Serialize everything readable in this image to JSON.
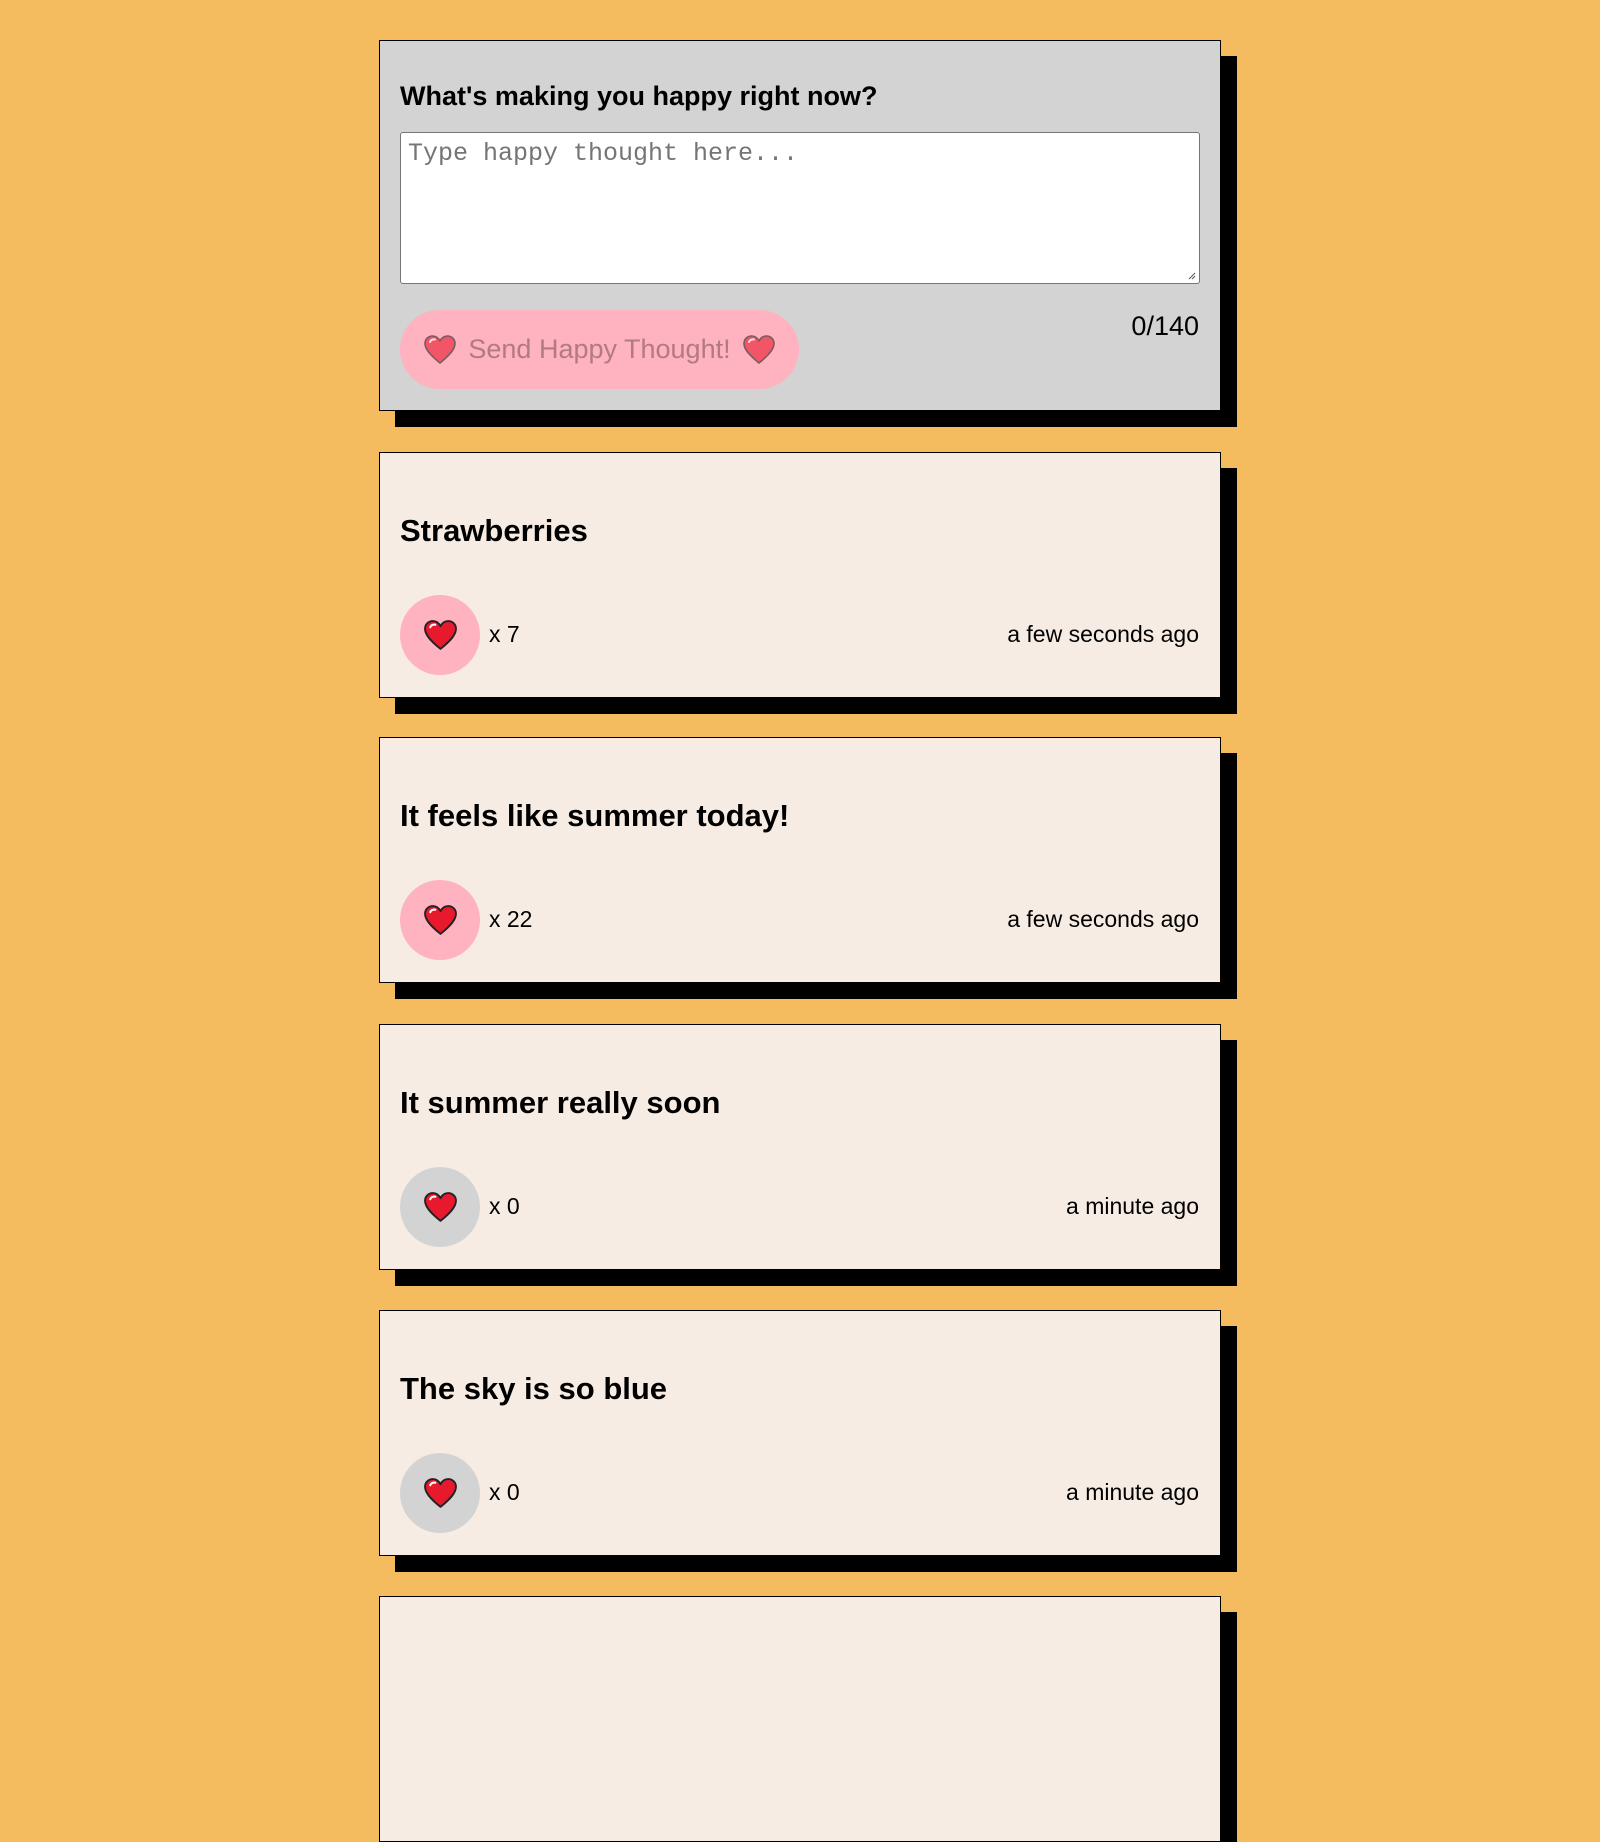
{
  "form": {
    "title": "What's making you happy right now?",
    "placeholder": "Type happy thought here...",
    "value": "",
    "send_label": "Send Happy Thought!",
    "char_count": "0/140"
  },
  "thoughts": [
    {
      "text": "Strawberries",
      "likes": "x 7",
      "time": "a few seconds ago",
      "liked": true
    },
    {
      "text": "It feels like summer today!",
      "likes": "x 22",
      "time": "a few seconds ago",
      "liked": true
    },
    {
      "text": "It summer really soon",
      "likes": "x 0",
      "time": "a minute ago",
      "liked": false
    },
    {
      "text": "The sky is so blue",
      "likes": "x 0",
      "time": "a minute ago",
      "liked": false
    }
  ],
  "icons": {
    "like": "heart-icon",
    "send": "heart-icon"
  },
  "colors": {
    "background": "#f4bc5e",
    "form_background": "#d3d3d3",
    "card_background": "#f6ece3",
    "button_pink": "#ffb2bf",
    "button_gray": "#d3d3d3",
    "heart_red": "#e8192c",
    "shadow": "#000000"
  }
}
